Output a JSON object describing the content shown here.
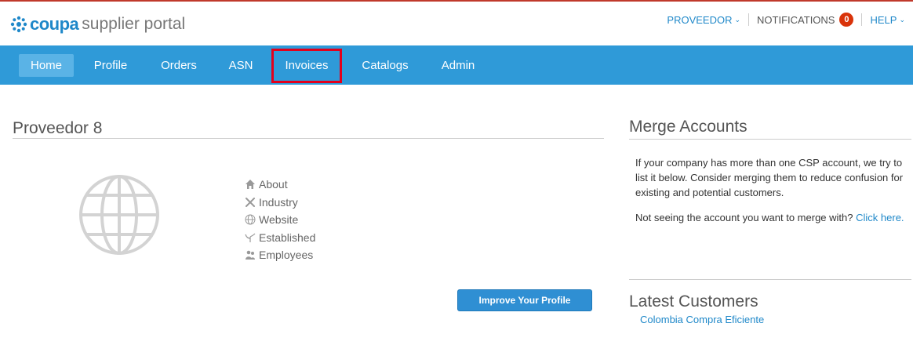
{
  "header": {
    "logo_coupa": "coupa",
    "logo_rest": "supplier portal",
    "account_menu": "PROVEEDOR",
    "notifications_label": "NOTIFICATIONS",
    "notifications_count": "0",
    "help_label": "HELP"
  },
  "nav": {
    "items": [
      {
        "label": "Home"
      },
      {
        "label": "Profile"
      },
      {
        "label": "Orders"
      },
      {
        "label": "ASN"
      },
      {
        "label": "Invoices"
      },
      {
        "label": "Catalogs"
      },
      {
        "label": "Admin"
      }
    ],
    "active": "Home",
    "highlighted": "Invoices"
  },
  "profile": {
    "title": "Proveedor 8",
    "info": [
      {
        "label": "About",
        "icon": "home-icon"
      },
      {
        "label": "Industry",
        "icon": "tools-icon"
      },
      {
        "label": "Website",
        "icon": "globe-icon"
      },
      {
        "label": "Established",
        "icon": "plant-icon"
      },
      {
        "label": "Employees",
        "icon": "people-icon"
      }
    ],
    "improve_button": "Improve Your Profile"
  },
  "merge": {
    "title": "Merge Accounts",
    "description": "If your company has more than one CSP account, we try to list it below. Consider merging them to reduce confusion for existing and potential customers.",
    "not_seeing": "Not seeing the account you want to merge with?",
    "click_here": "Click here."
  },
  "customers": {
    "title": "Latest Customers",
    "items": [
      "Colombia Compra Eficiente"
    ]
  },
  "colors": {
    "brand_blue": "#2f9ad8",
    "link_blue": "#1f88c9",
    "badge_red": "#d9330a",
    "highlight_red": "#e3001b"
  }
}
